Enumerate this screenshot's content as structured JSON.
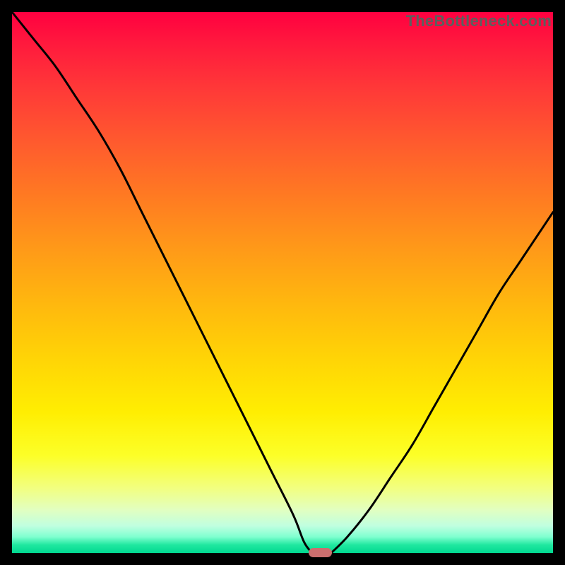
{
  "watermark": "TheBottleneck.com",
  "colors": {
    "frame": "#000000",
    "gradient_top": "#ff0040",
    "gradient_bottom": "#00d890",
    "curve": "#000000",
    "marker": "#cc6f6f"
  },
  "chart_data": {
    "type": "line",
    "title": "",
    "xlabel": "",
    "ylabel": "",
    "xlim": [
      0,
      100
    ],
    "ylim": [
      0,
      100
    ],
    "series": [
      {
        "name": "left-branch",
        "x": [
          0,
          4,
          8,
          12,
          16,
          20,
          24,
          28,
          32,
          36,
          40,
          44,
          48,
          52,
          54,
          55.5
        ],
        "values": [
          100,
          95,
          90,
          84,
          78,
          71,
          63,
          55,
          47,
          39,
          31,
          23,
          15,
          7,
          2,
          0
        ]
      },
      {
        "name": "right-branch",
        "x": [
          59,
          62,
          66,
          70,
          74,
          78,
          82,
          86,
          90,
          94,
          98,
          100
        ],
        "values": [
          0,
          3,
          8,
          14,
          20,
          27,
          34,
          41,
          48,
          54,
          60,
          63
        ]
      }
    ],
    "marker": {
      "x": 57,
      "y": 0,
      "width": 4.4
    },
    "annotations": []
  }
}
